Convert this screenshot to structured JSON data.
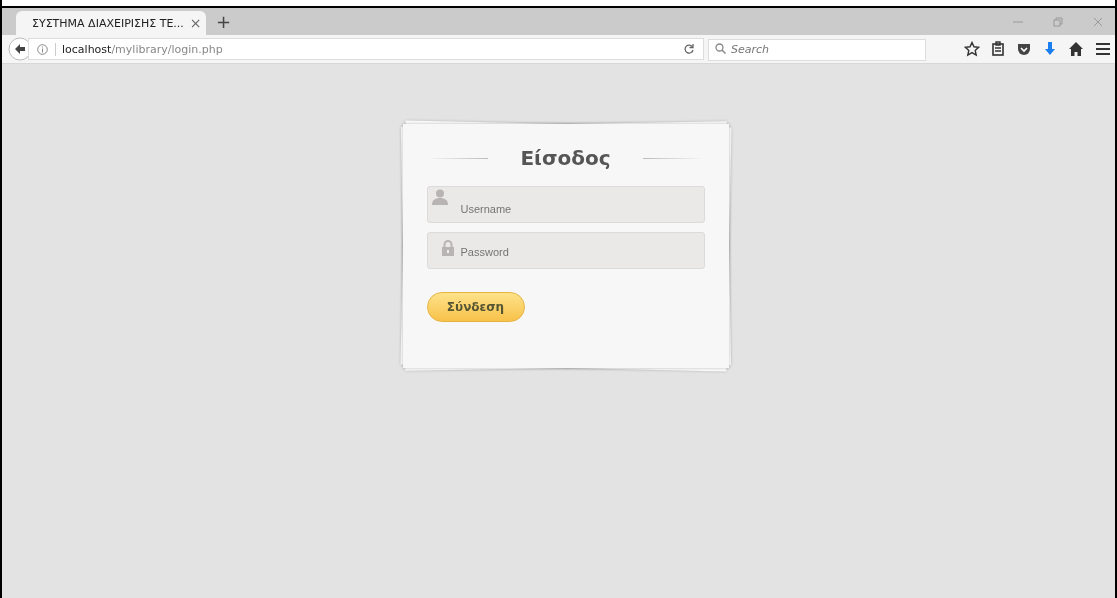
{
  "tab": {
    "title": "ΣΥΣΤΗΜΑ ΔΙΑΧΕΙΡΙΣΗΣ ΤΕ...",
    "close": "×",
    "selected": true
  },
  "new_tab": "+",
  "address": {
    "host": "localhost",
    "path": "/mylibrary/login.php"
  },
  "search": {
    "placeholder": "Search"
  },
  "login": {
    "title": "Είσοδος",
    "fields": [
      {
        "kind": "user",
        "placeholder": "Username"
      },
      {
        "kind": "lock",
        "placeholder": "Password"
      }
    ],
    "button": "Σύνδεση"
  }
}
